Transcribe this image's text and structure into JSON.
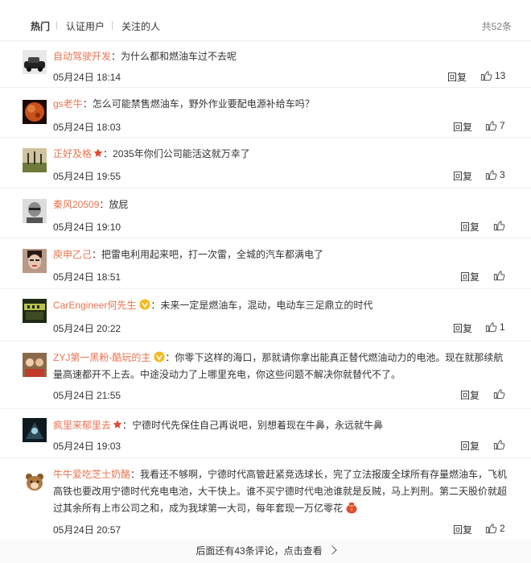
{
  "tabs": {
    "hot": "热门",
    "verified": "认证用户",
    "following": "关注的人"
  },
  "total": "共52条",
  "comments": [
    {
      "name": "自动驾驶开发",
      "colon": "：",
      "text": "为什么都和燃油车过不去呢",
      "time": "05月24日 18:14",
      "reply": "回复",
      "likes": "13"
    },
    {
      "name": "gs老牛",
      "colon": "：",
      "text": "怎么可能禁售燃油车，野外作业要配电源补给车吗？",
      "time": "05月24日 18:03",
      "reply": "回复",
      "likes": "7"
    },
    {
      "name": "正好及格",
      "colon": "：",
      "text": "2035年你们公司能活这就万幸了",
      "time": "05月24日 19:55",
      "reply": "回复",
      "likes": "3"
    },
    {
      "name": "秦风20509",
      "colon": "：",
      "text": "放屁",
      "time": "05月24日 19:10",
      "reply": "回复",
      "likes": ""
    },
    {
      "name": "庾申乙己",
      "colon": "：",
      "text": "把雷电利用起来吧，打一次雷，全城的汽车都满电了",
      "time": "05月24日 18:51",
      "reply": "回复",
      "likes": ""
    },
    {
      "name": "CarEngineer何先生",
      "colon": "：",
      "text": "未来一定是燃油车，混动，电动车三足鼎立的时代",
      "time": "05月24日 20:22",
      "reply": "回复",
      "likes": "1"
    },
    {
      "name": "ZYJ第一黑粉-酷玩的主",
      "colon": "：",
      "text": "你零下这样的海口，那就请你拿出能真正替代燃油动力的电池。现在就那续航量高速都开不上去。中途没动力了上哪里充电，你这些问题不解决你就替代不了。",
      "time": "05月24日 21:55",
      "reply": "回复",
      "likes": ""
    },
    {
      "name": "疯里来郁里去",
      "colon": "：",
      "text": "宁德时代先保住自己再说吧，别想着现在牛鼻，永远就牛鼻",
      "time": "05月24日 19:03",
      "reply": "回复",
      "likes": ""
    },
    {
      "name": "牛牛爱吃芝士奶酪",
      "colon": "：",
      "text": "我看还不够啊，宁德时代高管赶紧竞选球长，完了立法报废全球所有存量燃油车，飞机高铁也要改用宁德时代充电电池，大干快上。谁不买宁德时代电池谁就是反贼，马上判刑。第二天股价就超过其余所有上市公司之和，成为我球第一大司，每年套现一万亿零花",
      "time": "05月24日 20:57",
      "reply": "回复",
      "likes": "2"
    }
  ],
  "more_label": "后面还有43条评论，点击查看",
  "colors": {
    "accent": "#eb7350",
    "text": "#333333",
    "muted": "#808080"
  }
}
